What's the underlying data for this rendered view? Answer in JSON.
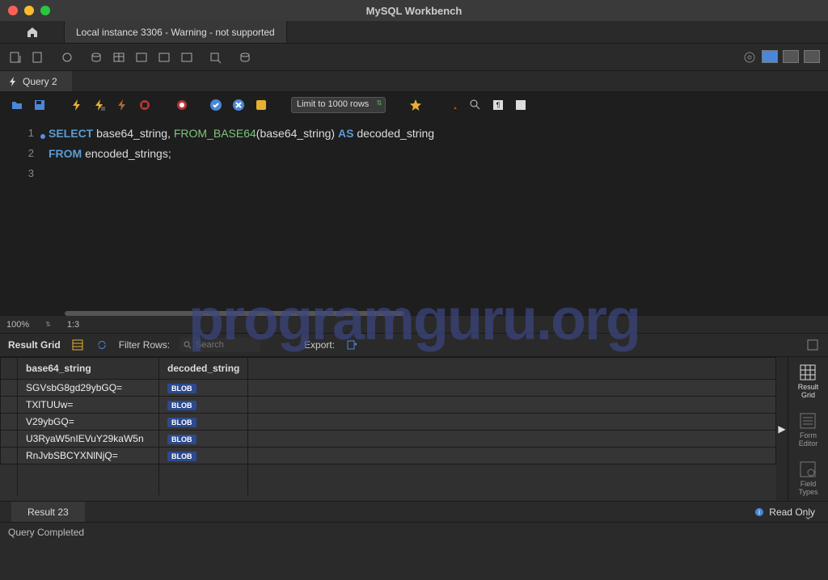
{
  "title": "MySQL Workbench",
  "connectionTab": "Local instance 3306 - Warning - not supported",
  "queryTab": "Query 2",
  "limitSelect": "Limit to 1000 rows",
  "sql": {
    "line1": {
      "select": "SELECT",
      "col1": "base64_string",
      "comma": ",",
      "fn": "FROM_BASE64",
      "paren1": "(",
      "arg": "base64_string",
      "paren2": ")",
      "as": "AS",
      "alias": "decoded_string"
    },
    "line2": {
      "from": "FROM",
      "tbl": "encoded_strings",
      "semi": ";"
    }
  },
  "zoom": "100%",
  "cursorPos": "1:3",
  "resultsLabel": "Result Grid",
  "filterLabel": "Filter Rows:",
  "filterPlaceholder": "Search",
  "exportLabel": "Export:",
  "columns": [
    "base64_string",
    "decoded_string"
  ],
  "rows": [
    {
      "c0": "SGVsbG8gd29ybGQ=",
      "c1": "BLOB"
    },
    {
      "c0": "TXlTUUw=",
      "c1": "BLOB"
    },
    {
      "c0": "V29ybGQ=",
      "c1": "BLOB"
    },
    {
      "c0": "U3RyaW5nIEVuY29kaW5n",
      "c1": "BLOB"
    },
    {
      "c0": "RnJvbSBCYXNlNjQ=",
      "c1": "BLOB"
    }
  ],
  "sideTools": {
    "resultGrid": "Result\nGrid",
    "formEditor": "Form\nEditor",
    "fieldTypes": "Field\nTypes"
  },
  "resultTab": "Result 23",
  "readOnly": "Read Only",
  "statusText": "Query Completed",
  "watermark": "programguru.org"
}
